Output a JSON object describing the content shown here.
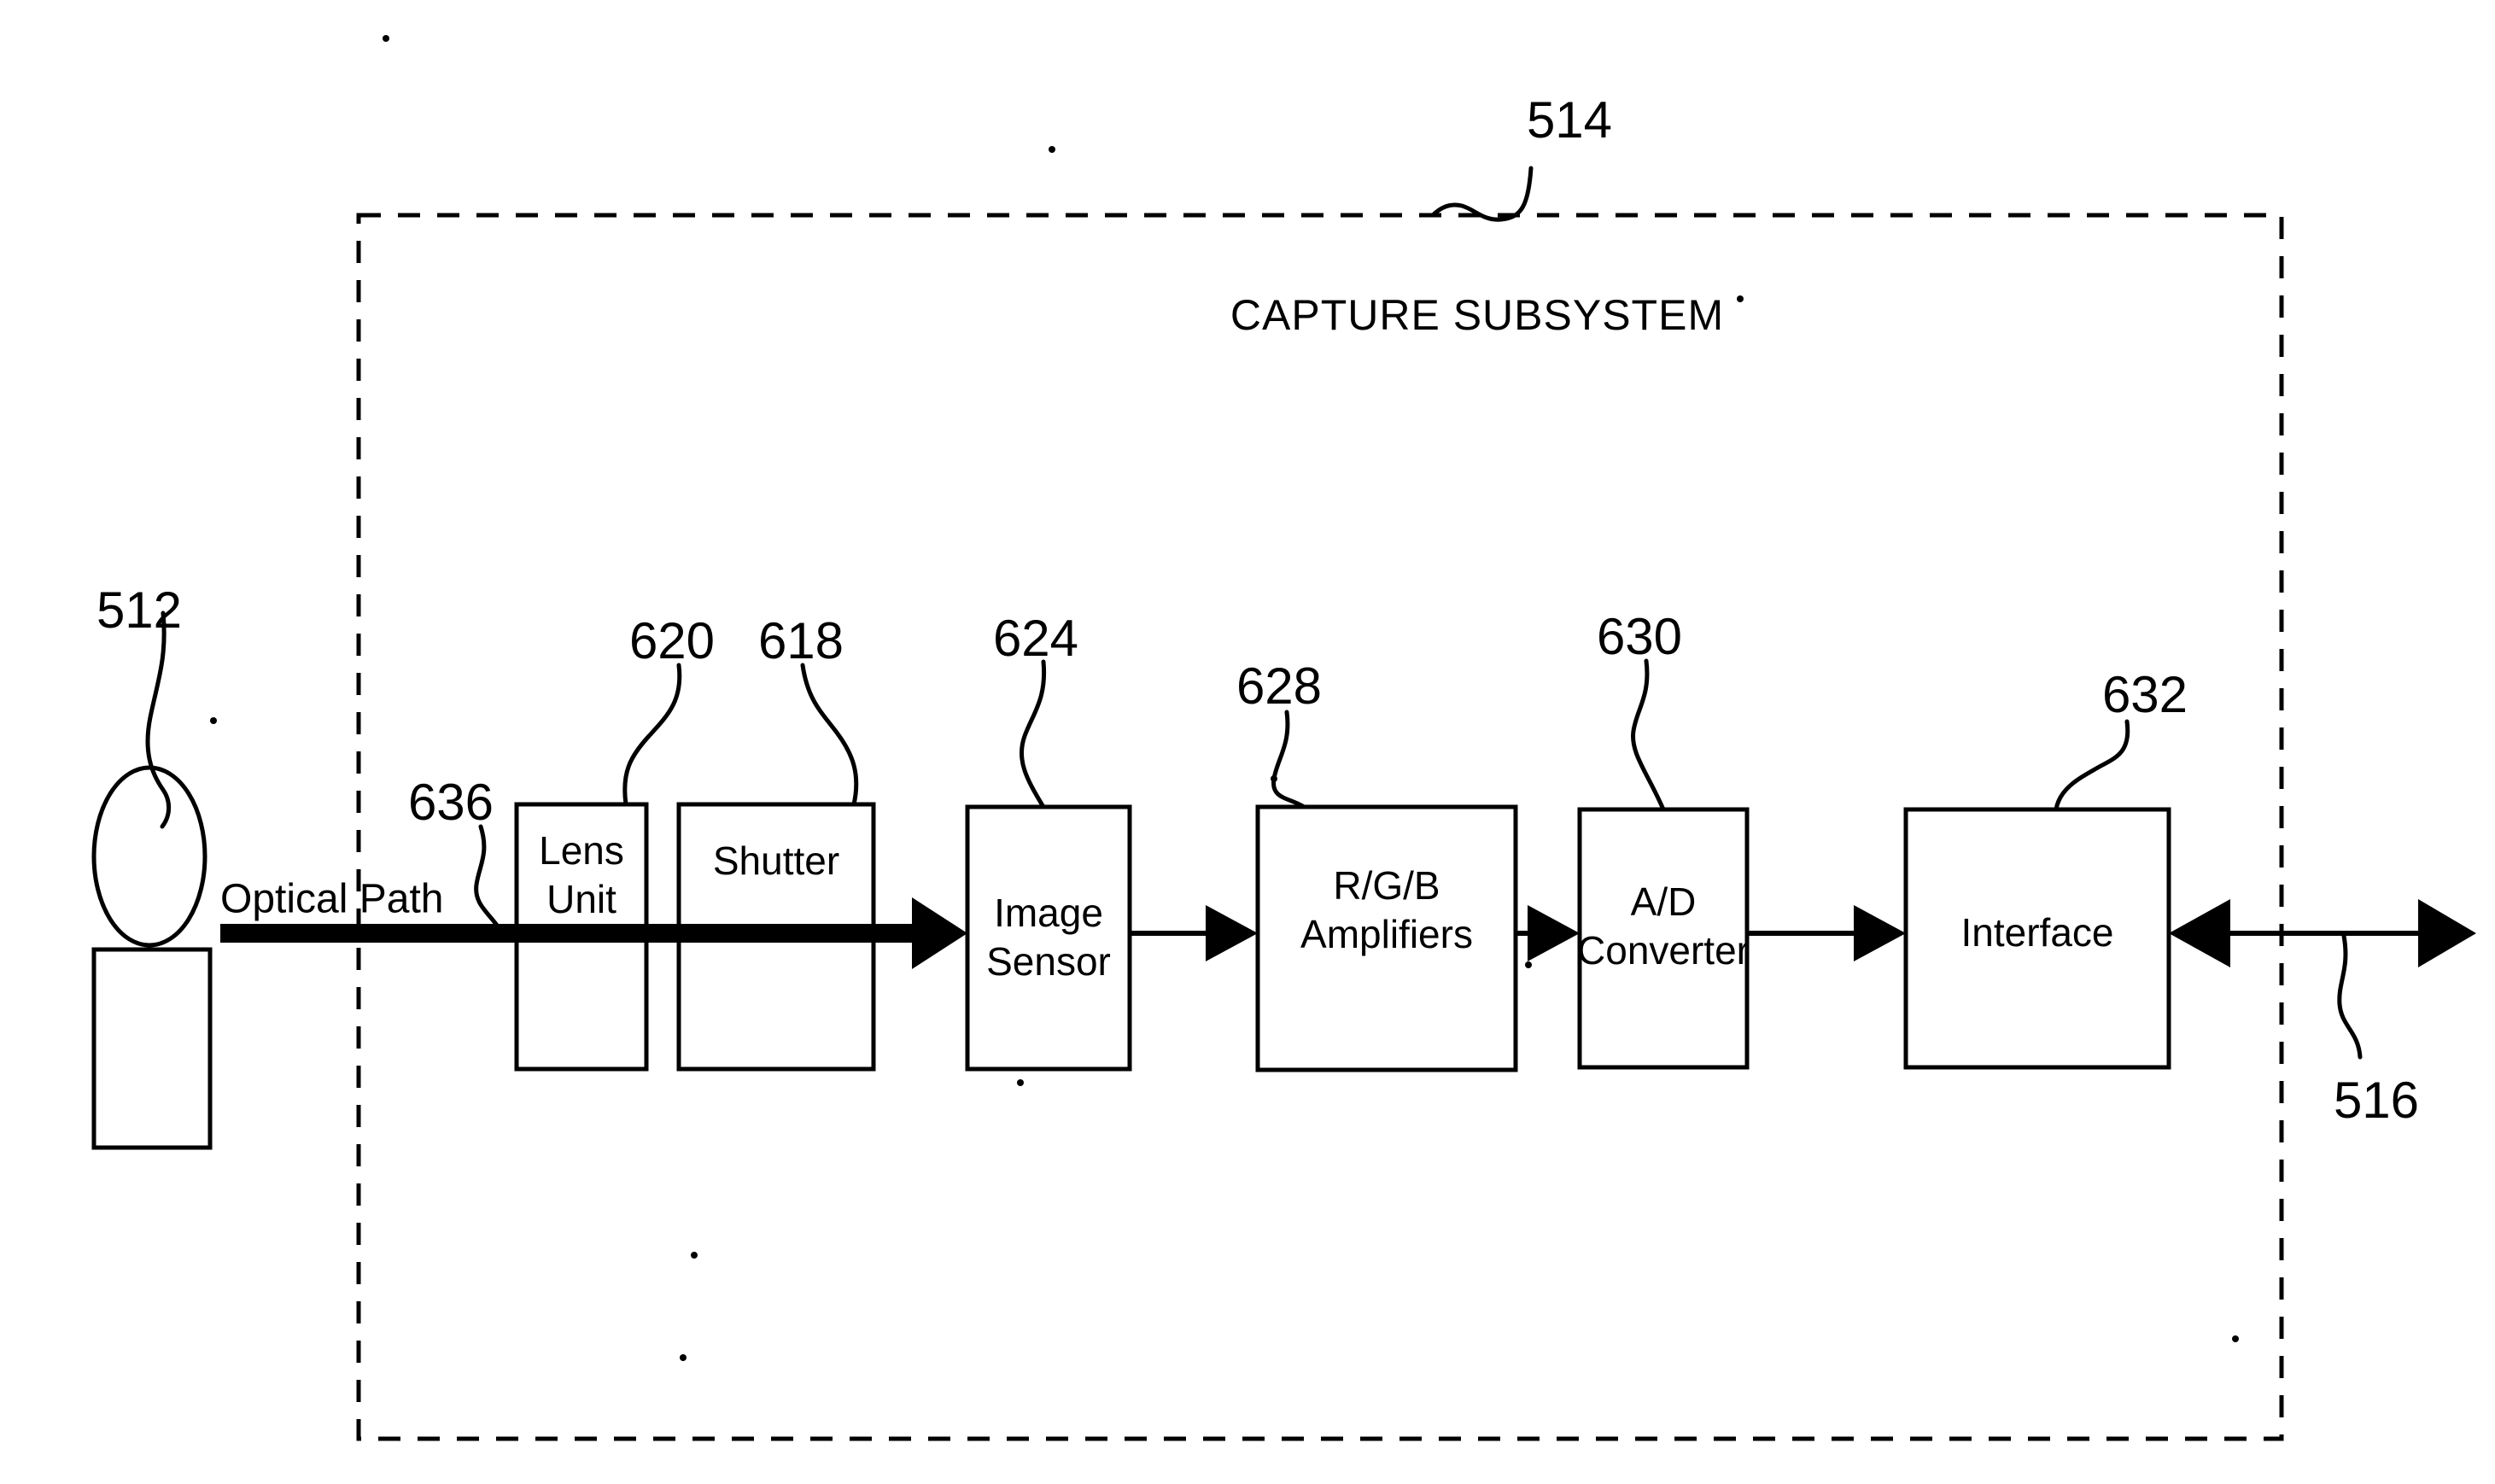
{
  "figure": {
    "kind": "patent-block-diagram",
    "background_color": "#ffffff",
    "line_color": "#000000",
    "subsystem": {
      "title": "CAPTURE SUBSYSTEM",
      "ref": "514",
      "border_style": "dashed"
    },
    "subject": {
      "ref": "512",
      "shape": "person-head-and-body"
    },
    "optical_path": {
      "label": "Optical Path",
      "ref": "636"
    },
    "external_connection": {
      "ref": "516",
      "direction": "bidirectional"
    },
    "blocks": [
      {
        "id": "lens-unit",
        "label_line1": "Lens",
        "label_line2": "Unit",
        "ref": "620"
      },
      {
        "id": "shutter",
        "label_line1": "Shutter",
        "label_line2": "",
        "ref": "618"
      },
      {
        "id": "image-sensor",
        "label_line1": "Image",
        "label_line2": "Sensor",
        "ref": "624"
      },
      {
        "id": "rgb-amplifiers",
        "label_line1": "R/G/B",
        "label_line2": "Amplifiers",
        "ref": "628"
      },
      {
        "id": "ad-converter",
        "label_line1": "A/D",
        "label_line2": "Converter",
        "ref": "630"
      },
      {
        "id": "interface",
        "label_line1": "Interface",
        "label_line2": "",
        "ref": "632"
      }
    ]
  }
}
